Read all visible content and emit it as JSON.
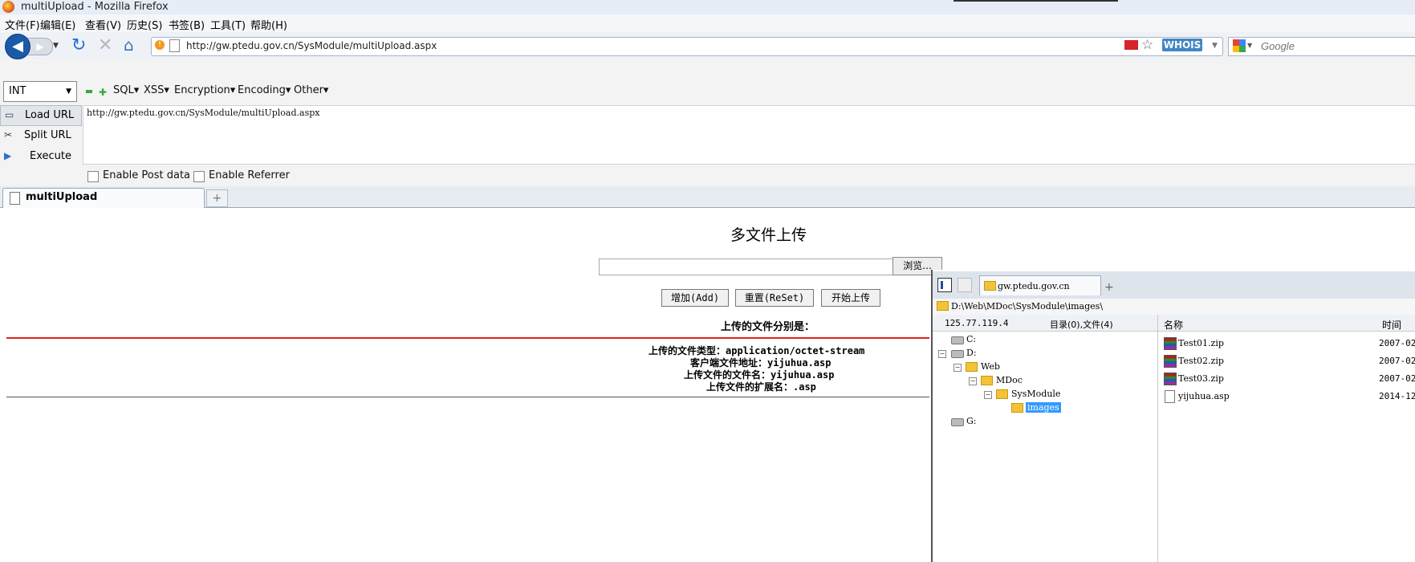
{
  "window": {
    "title": "multiUpload - Mozilla Firefox"
  },
  "menubar": [
    "文件(F)",
    "编辑(E)",
    "查看(V)",
    "历史(S)",
    "书签(B)",
    "工具(T)",
    "帮助(H)"
  ],
  "navbar": {
    "url": "http://gw.ptedu.gov.cn/SysModule/multiUpload.aspx",
    "whois": "WHOIS",
    "search_placeholder": "Google"
  },
  "hackbar": {
    "select_value": "INT",
    "menus": [
      "SQL",
      "XSS",
      "Encryption",
      "Encoding",
      "Other"
    ],
    "load_url": "Load URL",
    "split_url": "Split URL",
    "execute": "Execute",
    "text": "http://gw.ptedu.gov.cn/SysModule/multiUpload.aspx",
    "enable_post": "Enable Post data",
    "enable_referrer": "Enable Referrer"
  },
  "tab": {
    "title": "multiUpload",
    "new_tab": "+"
  },
  "page": {
    "title": "多文件上传",
    "browse": "浏览...",
    "add": "增加(Add)",
    "reset": "重置(ReSet)",
    "start": "开始上传",
    "uploaded_header": "上传的文件分别是：",
    "info": [
      "上传的文件类型：application/octet-stream",
      "客户端文件地址：yijuhua.asp",
      "上传文件的文件名：yijuhua.asp",
      "上传文件的扩展名：.asp"
    ]
  },
  "file_manager": {
    "tab_title": "gw.ptedu.gov.cn",
    "new_tab": "+",
    "path": "D:\\Web\\MDoc\\SysModule\\images\\",
    "ip": "125.77.119.4",
    "counts": "目录(0),文件(4)",
    "col_name": "名称",
    "col_time": "时间",
    "tree": {
      "c": "C:",
      "d": "D:",
      "web": "Web",
      "mdoc": "MDoc",
      "sysmodule": "SysModule",
      "images": "images",
      "g": "G:"
    },
    "files": [
      {
        "name": "Test01.zip",
        "time": "2007-02"
      },
      {
        "name": "Test02.zip",
        "time": "2007-02"
      },
      {
        "name": "Test03.zip",
        "time": "2007-02"
      },
      {
        "name": "yijuhua.asp",
        "time": "2014-12"
      }
    ]
  }
}
